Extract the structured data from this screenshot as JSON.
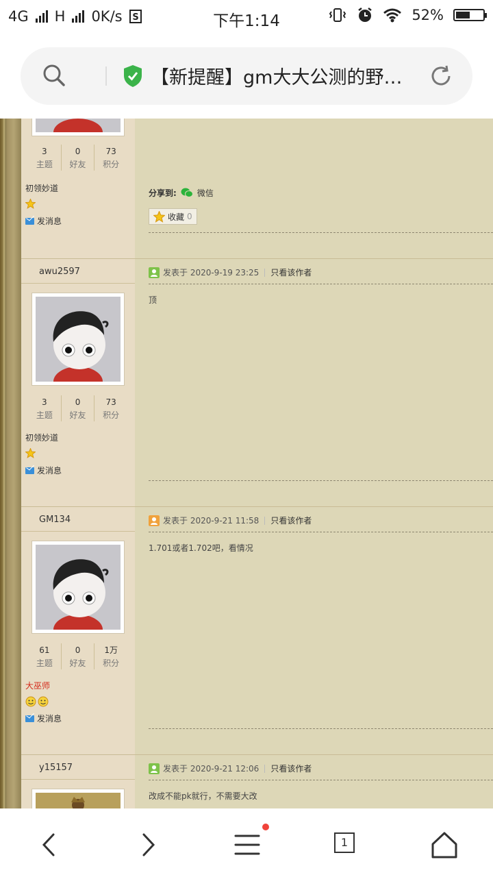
{
  "status_bar": {
    "network": "4G",
    "network2": "H",
    "speed": "0K/s",
    "time": "下午1:14",
    "battery": "52%",
    "battery_level": 0.52
  },
  "browser": {
    "page_title": "【新提醒】gm大大公测的野…",
    "tab_count": "1"
  },
  "posts": [
    {
      "stats": [
        {
          "num": "3",
          "label": "主题"
        },
        {
          "num": "0",
          "label": "好友"
        },
        {
          "num": "73",
          "label": "积分"
        }
      ],
      "rank": "初领妙道",
      "send_message": "发消息",
      "share_label": "分享到:",
      "share_target": "微信",
      "collect_label": "收藏",
      "collect_count": "0"
    },
    {
      "username": "awu2597",
      "posted": "发表于 2020-9-19 23:25",
      "only_author": "只看该作者",
      "content": "顶",
      "stats": [
        {
          "num": "3",
          "label": "主题"
        },
        {
          "num": "0",
          "label": "好友"
        },
        {
          "num": "73",
          "label": "积分"
        }
      ],
      "rank": "初领妙道",
      "send_message": "发消息"
    },
    {
      "username": "GM134",
      "posted": "发表于 2020-9-21 11:58",
      "only_author": "只看该作者",
      "content": "1.701或者1.702吧，看情况",
      "stats": [
        {
          "num": "61",
          "label": "主题"
        },
        {
          "num": "0",
          "label": "好友"
        },
        {
          "num": "1万",
          "label": "积分"
        }
      ],
      "rank": "大巫师",
      "send_message": "发消息"
    },
    {
      "username": "y15157",
      "posted": "发表于 2020-9-21 12:06",
      "only_author": "只看该作者",
      "content": "改成不能pk就行，不需要大改"
    }
  ],
  "colors": {
    "post_bg": "#ddd7b7",
    "side_bg": "#e8dcc5",
    "rank_red": "#d42a1a",
    "secure_green": "#3bb34a"
  }
}
